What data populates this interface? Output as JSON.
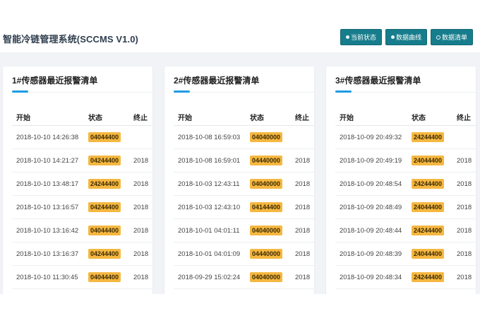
{
  "header": {
    "title": "智能冷链管理系统(SCCMS V1.0)",
    "nav": [
      {
        "label": "当前状态"
      },
      {
        "label": "数据曲线"
      },
      {
        "label": "数据清单"
      }
    ]
  },
  "colors": {
    "accent": "#177d8c",
    "badge": "#f5b740",
    "underline": "#1e9be3"
  },
  "panels": [
    {
      "title": "1#传感器最近报警清单",
      "columns": [
        "开始",
        "状态",
        "终止"
      ],
      "rows": [
        {
          "start": "2018-10-10 14:26:38",
          "status": "04044400",
          "end": ""
        },
        {
          "start": "2018-10-10 14:21:27",
          "status": "04244400",
          "end": "2018"
        },
        {
          "start": "2018-10-10 13:48:17",
          "status": "24244400",
          "end": "2018"
        },
        {
          "start": "2018-10-10 13:16:57",
          "status": "04244400",
          "end": "2018"
        },
        {
          "start": "2018-10-10 13:16:42",
          "status": "04044400",
          "end": "2018"
        },
        {
          "start": "2018-10-10 13:16:37",
          "status": "04244400",
          "end": "2018"
        },
        {
          "start": "2018-10-10 11:30:45",
          "status": "04044400",
          "end": "2018"
        }
      ]
    },
    {
      "title": "2#传感器最近报警清单",
      "columns": [
        "开始",
        "状态",
        "终止"
      ],
      "rows": [
        {
          "start": "2018-10-08 16:59:03",
          "status": "04040000",
          "end": ""
        },
        {
          "start": "2018-10-08 16:59:01",
          "status": "04440000",
          "end": "2018"
        },
        {
          "start": "2018-10-03 12:43:11",
          "status": "04040000",
          "end": "2018"
        },
        {
          "start": "2018-10-03 12:43:10",
          "status": "04144400",
          "end": "2018"
        },
        {
          "start": "2018-10-01 04:01:11",
          "status": "04040000",
          "end": "2018"
        },
        {
          "start": "2018-10-01 04:01:09",
          "status": "04440000",
          "end": "2018"
        },
        {
          "start": "2018-09-29 15:02:24",
          "status": "04040000",
          "end": "2018"
        }
      ]
    },
    {
      "title": "3#传感器最近报警清单",
      "columns": [
        "开始",
        "状态",
        "终止"
      ],
      "rows": [
        {
          "start": "2018-10-09 20:49:32",
          "status": "24244400",
          "end": ""
        },
        {
          "start": "2018-10-09 20:49:19",
          "status": "24044400",
          "end": "2018"
        },
        {
          "start": "2018-10-09 20:48:54",
          "status": "24244400",
          "end": "2018"
        },
        {
          "start": "2018-10-09 20:48:49",
          "status": "24044400",
          "end": "2018"
        },
        {
          "start": "2018-10-09 20:48:44",
          "status": "24244400",
          "end": "2018"
        },
        {
          "start": "2018-10-09 20:48:39",
          "status": "24044400",
          "end": "2018"
        },
        {
          "start": "2018-10-09 20:48:34",
          "status": "24244400",
          "end": "2018"
        }
      ]
    }
  ]
}
